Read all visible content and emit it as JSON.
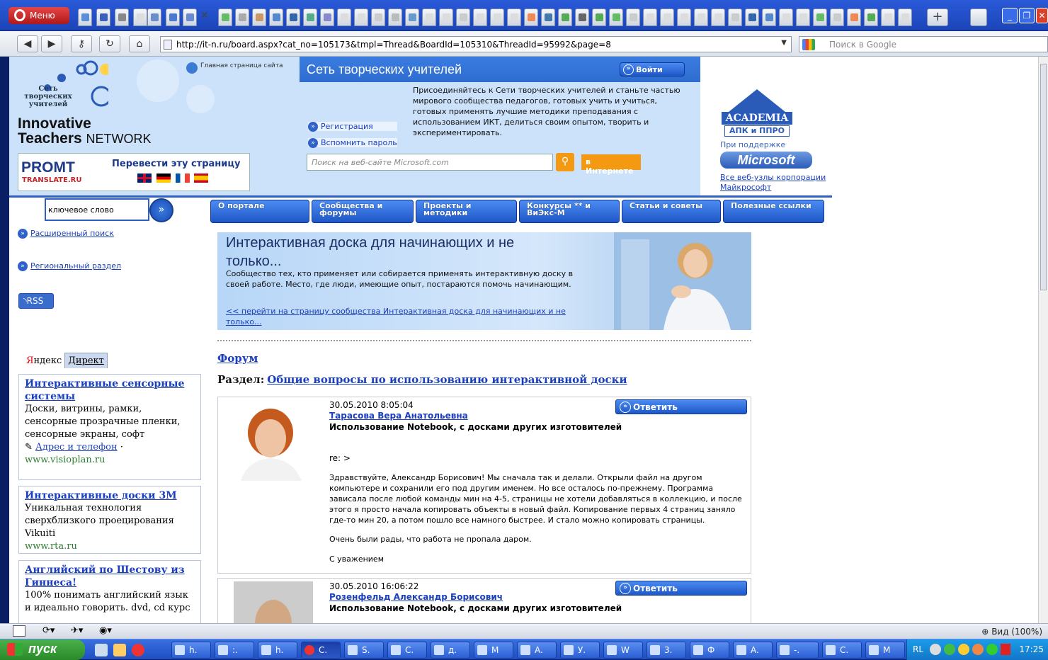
{
  "browser": {
    "menu_label": "Меню",
    "address_url": "http://it-n.ru/board.aspx?cat_no=105173&tmpl=Thread&BoardId=105310&ThreadId=95992&page=8",
    "search_placeholder": "Поиск в Google",
    "zoom_label": "Вид (100%)"
  },
  "header": {
    "home_link": "Главная страница сайта",
    "logo_text": "Сеть творческих учителей",
    "brand_line1": "Innovative",
    "brand_line2a": "Teachers ",
    "brand_line2b": "NETWORK",
    "promt_brand": "PROMT",
    "promt_sub": "TRANSLATE.RU",
    "promt_translate": "Перевести эту страницу",
    "network_title": "Сеть творческих учителей",
    "login_button": "Войти",
    "join_text": "Присоединяйтесь к Сети творческих учителей и станьте частью мирового сообщества педагогов, готовых учить и учиться, готовых применять лучшие методики преподавания с использованием ИКТ, делиться своим опытом, творить и экспериментировать.",
    "register_link": "Регистрация",
    "remember_link": "Вспомнить пароль",
    "ms_search_placeholder": "Поиск на веб-сайте Microsoft.com",
    "ms_web_button": "в Интернете",
    "academia_name": "ACADEMIA",
    "academia_sub": "АПК и ППРО",
    "support_text": "При поддержке",
    "microsoft": "Microsoft",
    "ms_sites_link": "Все веб-узлы корпорации Майкрософт"
  },
  "left": {
    "keyword_value": "ключевое слово",
    "advanced_search": "Расширенный поиск",
    "regional": "Региональный раздел",
    "rss": "RSS"
  },
  "nav": {
    "tabs": [
      "О портале",
      "Сообщества и форумы",
      "Проекты и методики",
      "Конкурсы ** и ВиЭкс-М",
      "Статьи и советы",
      "Полезные ссылки"
    ]
  },
  "banner": {
    "title": "Интерактивная доска для начинающих и не только...",
    "desc": "Сообщество тех, кто применяет или собирается применять интерактивную доску в своей работе. Место, где люди, имеющие опыт, постараются помочь начинающим.",
    "link": "<< перейти на страницу сообщества Интерактивная доска для начинающих и не только..."
  },
  "forum": {
    "label": "Форум",
    "section_prefix": "Раздел:",
    "section_link": "Общие вопросы по использованию интерактивной доски",
    "reply_label": "Ответить",
    "posts": [
      {
        "date": "30.05.2010 8:05:04",
        "author": "Тарасова Вера Анатольевна",
        "title": "Использование Notebook, с досками других изготовителей",
        "re": "re: >",
        "body": "Здравствуйте, Александр Борисович! Мы сначала так и делали. Открыли файл на другом компьютере и сохранили его под другим именем. Но все осталось по-прежнему. Программа зависала после любой команды мин на 4-5, страницы не хотели добавляться в коллекцию, и после этого я просто начала копировать объекты  в новый файл. Копирование первых 4 страниц заняло где-то мин 20, а потом пошло все намного быстрее. И стало можно копировать страницы.",
        "body2": "Очень были рады, что работа не пропала даром.",
        "sign": "С уважением"
      },
      {
        "date": "30.05.2010 16:06:22",
        "author": "Розенфельд Александр Борисович",
        "title": "Использование Notebook, с досками других изготовителей"
      }
    ]
  },
  "ads": {
    "tab1_a": "Я",
    "tab1_b": "ндекс",
    "tab2": "Директ",
    "items": [
      {
        "title": "Интерактивные сенсорные системы",
        "text": "Доски, витрины, рамки, сенсорные прозрачные пленки, сенсорные экраны, софт",
        "extra": "Адрес и телефон",
        "url": "www.visioplan.ru"
      },
      {
        "title": "Интерактивные доски 3M",
        "text": "Уникальная технология сверхблизкого проецирования Vikuiti",
        "url": "www.rta.ru"
      },
      {
        "title": "Английский по Шестову из Гиннеса!",
        "text": "100% понимать английский язык и идеально говорить. dvd, cd курс"
      }
    ]
  },
  "taskbar": {
    "start": "пуск",
    "items": [
      "h.",
      ":.",
      "h.",
      "C.",
      "S.",
      "C.",
      "д.",
      "M",
      "A.",
      "У.",
      "W",
      "3.",
      "Ф",
      "A.",
      "-.",
      "C.",
      "M"
    ],
    "lang": "RL",
    "clock": "17:25"
  },
  "colors": {
    "accent": "#2e5fc4",
    "header_bg": "#cbe2fa",
    "link": "#1a3fbf"
  }
}
